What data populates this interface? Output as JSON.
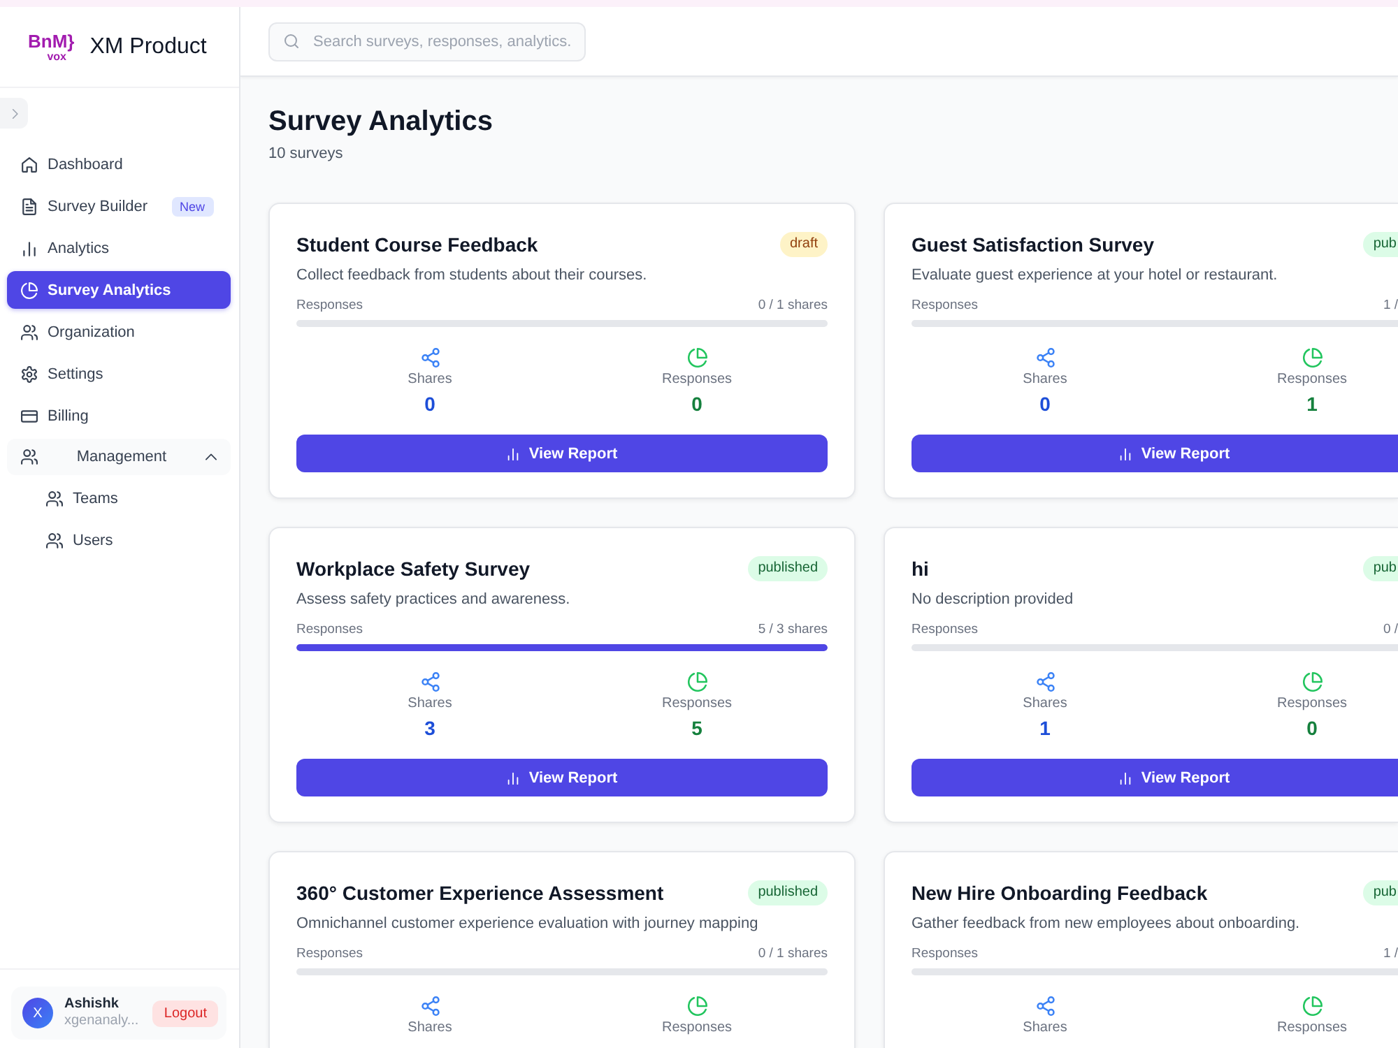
{
  "sidebar": {
    "logo": {
      "mark": "BnM}",
      "sub": "vox"
    },
    "brand": "XM Product",
    "nav": [
      {
        "label": "Dashboard",
        "selected": false
      },
      {
        "label": "Survey Builder",
        "badge": "New",
        "selected": false
      },
      {
        "label": "Analytics",
        "selected": false
      },
      {
        "label": "Survey Analytics",
        "selected": true
      },
      {
        "label": "Organization",
        "selected": false
      },
      {
        "label": "Settings",
        "selected": false
      },
      {
        "label": "Billing",
        "selected": false
      },
      {
        "label": "Management",
        "selected": false,
        "expanded": true,
        "children": [
          {
            "label": "Teams",
            "selected": false
          },
          {
            "label": "Users",
            "selected": false
          }
        ]
      }
    ],
    "user": {
      "avatar": "X",
      "name": "Ashishk",
      "email": "xgenanaly...",
      "logout": "Logout"
    }
  },
  "header": {
    "search": {
      "placeholder": "Search surveys, responses, analytics."
    }
  },
  "page": {
    "title": "Survey Analytics",
    "subtitle": "10 surveys"
  },
  "surveys": [
    {
      "title": "Student Course Feedback",
      "badge": {
        "text": "draft",
        "kind": "draft"
      },
      "description": "Collect feedback from students about their courses.",
      "progress_label": "Responses",
      "progress_text": "0 / 1 shares",
      "level": 0,
      "stats": [
        {
          "kind": "shares",
          "label": "Shares",
          "value": "0"
        },
        {
          "kind": "responses",
          "label": "Responses",
          "value": "0"
        }
      ],
      "button": "View Report"
    },
    {
      "title": "Guest Satisfaction Survey",
      "badge": {
        "text": "pub",
        "kind": "published"
      },
      "description": "Evaluate guest experience at your hotel or restaurant.",
      "progress_label": "Responses",
      "progress_text": "1 /",
      "level": 0,
      "stats": [
        {
          "kind": "shares",
          "label": "Shares",
          "value": "0"
        },
        {
          "kind": "responses",
          "label": "Responses",
          "value": "1"
        }
      ],
      "button": "View Report"
    },
    {
      "title": "Workplace Safety Survey",
      "badge": {
        "text": "published",
        "kind": "published"
      },
      "description": "Assess safety practices and awareness.",
      "progress_label": "Responses",
      "progress_text": "5 / 3 shares",
      "level": 1,
      "stats": [
        {
          "kind": "shares",
          "label": "Shares",
          "value": "3"
        },
        {
          "kind": "responses",
          "label": "Responses",
          "value": "5"
        }
      ],
      "button": "View Report"
    },
    {
      "title": "hi",
      "badge": {
        "text": "pub",
        "kind": "published"
      },
      "description": "No description provided",
      "progress_label": "Responses",
      "progress_text": "0 /",
      "level": 0,
      "stats": [
        {
          "kind": "shares",
          "label": "Shares",
          "value": "1"
        },
        {
          "kind": "responses",
          "label": "Responses",
          "value": "0"
        }
      ],
      "button": "View Report"
    },
    {
      "title": "360° Customer Experience Assessment",
      "badge": {
        "text": "published",
        "kind": "published"
      },
      "description": "Omnichannel customer experience evaluation with journey mapping",
      "progress_label": "Responses",
      "progress_text": "0 / 1 shares",
      "level": 0,
      "stats": [
        {
          "kind": "shares",
          "label": "Shares"
        },
        {
          "kind": "responses",
          "label": "Responses"
        }
      ]
    },
    {
      "title": "New Hire Onboarding Feedback",
      "badge": {
        "text": "pub",
        "kind": "published"
      },
      "description": "Gather feedback from new employees about onboarding.",
      "progress_label": "Responses",
      "progress_text": "1 /",
      "level": 0,
      "stats": [
        {
          "kind": "shares",
          "label": "Shares"
        },
        {
          "kind": "responses",
          "label": "Responses"
        }
      ]
    }
  ]
}
